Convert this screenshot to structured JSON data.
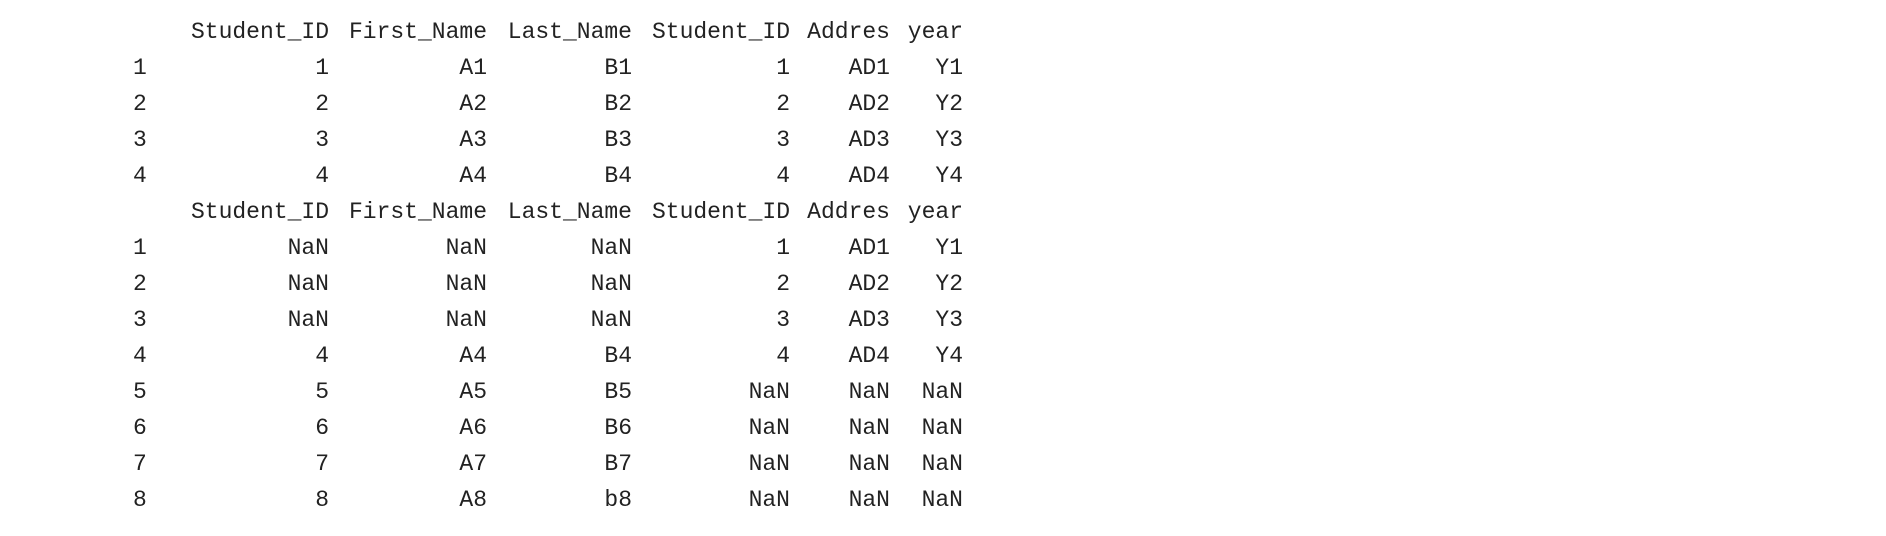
{
  "tables": [
    {
      "columns": [
        "",
        "Student_ID",
        "First_Name",
        "Last_Name",
        "Student_ID",
        "Addres",
        "year"
      ],
      "rows": [
        [
          "1",
          "1",
          "A1",
          "B1",
          "1",
          "AD1",
          "Y1"
        ],
        [
          "2",
          "2",
          "A2",
          "B2",
          "2",
          "AD2",
          "Y2"
        ],
        [
          "3",
          "3",
          "A3",
          "B3",
          "3",
          "AD3",
          "Y3"
        ],
        [
          "4",
          "4",
          "A4",
          "B4",
          "4",
          "AD4",
          "Y4"
        ]
      ]
    },
    {
      "columns": [
        "",
        "Student_ID",
        "First_Name",
        "Last_Name",
        "Student_ID",
        "Addres",
        "year"
      ],
      "rows": [
        [
          "1",
          "NaN",
          "NaN",
          "NaN",
          "1",
          "AD1",
          "Y1"
        ],
        [
          "2",
          "NaN",
          "NaN",
          "NaN",
          "2",
          "AD2",
          "Y2"
        ],
        [
          "3",
          "NaN",
          "NaN",
          "NaN",
          "3",
          "AD3",
          "Y3"
        ],
        [
          "4",
          "4",
          "A4",
          "B4",
          "4",
          "AD4",
          "Y4"
        ],
        [
          "5",
          "5",
          "A5",
          "B5",
          "NaN",
          "NaN",
          "NaN"
        ],
        [
          "6",
          "6",
          "A6",
          "B6",
          "NaN",
          "NaN",
          "NaN"
        ],
        [
          "7",
          "7",
          "A7",
          "B7",
          "NaN",
          "NaN",
          "NaN"
        ],
        [
          "8",
          "8",
          "A8",
          "b8",
          "NaN",
          "NaN",
          "NaN"
        ]
      ]
    }
  ]
}
